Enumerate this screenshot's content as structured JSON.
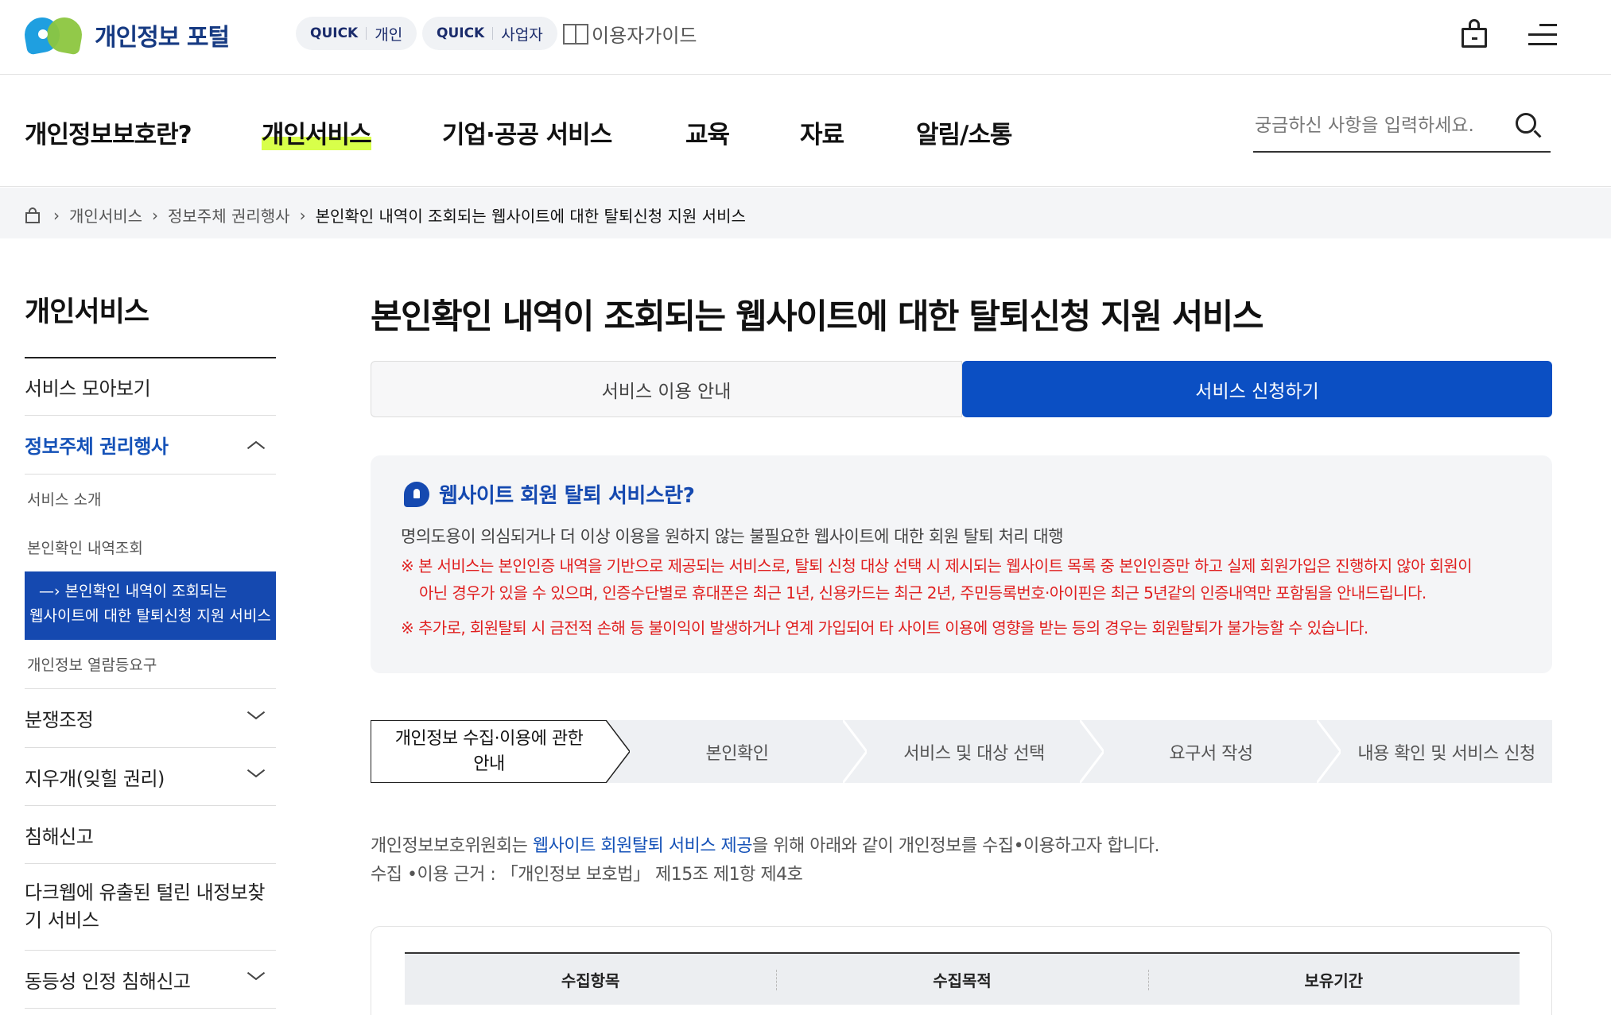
{
  "header": {
    "logo_text": "개인정보 포털",
    "quick_personal": {
      "tag": "QUICK",
      "label": "개인"
    },
    "quick_business": {
      "tag": "QUICK",
      "label": "사업자"
    },
    "guide_label": "이용자가이드"
  },
  "gnb": {
    "items": [
      "개인정보보호란?",
      "개인서비스",
      "기업·공공 서비스",
      "교육",
      "자료",
      "알림/소통"
    ],
    "active_index": 1,
    "search_placeholder": "궁금하신 사항을 입력하세요."
  },
  "breadcrumb": [
    "개인서비스",
    "정보주체 권리행사",
    "본인확인 내역이 조회되는 웹사이트에 대한 탈퇴신청 지원 서비스"
  ],
  "sidebar": {
    "title": "개인서비스",
    "items": [
      {
        "label": "서비스 모아보기"
      },
      {
        "label": "정보주체 권리행사",
        "open": true
      },
      {
        "label": "분쟁조정"
      },
      {
        "label": "지우개(잊힐 권리)"
      },
      {
        "label": "침해신고"
      },
      {
        "label": "다크웹에 유출된 털린 내정보찾기 서비스"
      },
      {
        "label": "동등성 인정 침해신고"
      }
    ],
    "subitems": [
      {
        "label": "서비스 소개"
      },
      {
        "label": "본인확인 내역조회"
      },
      {
        "label_line1": "본인확인 내역이 조회되는",
        "label_line2": "웹사이트에 대한 탈퇴신청 지원 서비스",
        "active": true
      },
      {
        "label": "개인정보 열람등요구"
      }
    ]
  },
  "main": {
    "title": "본인확인 내역이 조회되는 웹사이트에 대한 탈퇴신청 지원 서비스",
    "tabs": [
      {
        "label": "서비스 이용 안내",
        "active": false
      },
      {
        "label": "서비스 신청하기",
        "active": true
      }
    ],
    "info": {
      "heading": "웹사이트 회원 탈퇴 서비스란?",
      "description": "명의도용이 의심되거나 더 이상 이용을 원하지 않는 불필요한 웹사이트에 대한 회원 탈퇴 처리 대행",
      "warn_mark": "※",
      "warn1_line1": "본 서비스는 본인인증 내역을 기반으로 제공되는 서비스로, 탈퇴 신청 대상 선택 시 제시되는 웹사이트 목록 중 본인인증만 하고 실제 회원가입은 진행하지 않아 회원이",
      "warn1_line2": "아닌 경우가 있을 수 있으며, 인증수단별로 휴대폰은 최근 1년, 신용카드는 최근 2년, 주민등록번호·아이핀은 최근 5년같의 인증내역만 포함됨을 안내드립니다.",
      "warn2": "추가로, 회원탈퇴 시 금전적 손해 등 불이익이 발생하거나 연계 가입되어 타 사이트 이용에 영향을 받는 등의 경우는 회원탈퇴가 불가능할 수 있습니다."
    },
    "steps": [
      {
        "label_line1": "개인정보 수집·이용에 관한",
        "label_line2": "안내",
        "active": true
      },
      {
        "label": "본인확인"
      },
      {
        "label": "서비스 및 대상 선택"
      },
      {
        "label": "요구서 작성"
      },
      {
        "label": "내용 확인 및 서비스 신청"
      }
    ],
    "intro": {
      "prefix": "개인정보보호위원회는 ",
      "highlight": "웹사이트 회원탈퇴 서비스 제공",
      "suffix": "을 위해 아래와 같이 개인정보를 수집•이용하고자 합니다.",
      "basis": "수집 •이용 근거 : 「개인정보 보호법」 제15조 제1항 제4호"
    },
    "table_headers": [
      "수집항목",
      "수집목적",
      "보유기간"
    ]
  },
  "colors": {
    "primary": "#0b4fc3",
    "sidebar_active": "#1549b0",
    "warning": "#e01f1f",
    "gnb_highlight": "#d8ff4a",
    "logo_blue": "#1f9fe0",
    "logo_green": "#8cc63f"
  }
}
